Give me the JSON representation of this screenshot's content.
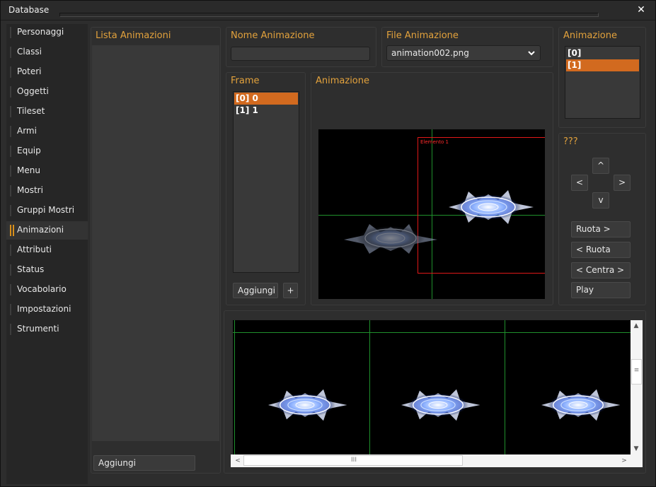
{
  "window": {
    "title": "Database",
    "close_symbol": "✕"
  },
  "sidebar": {
    "items": [
      {
        "label": "Personaggi",
        "active": false
      },
      {
        "label": "Classi",
        "active": false
      },
      {
        "label": "Poteri",
        "active": false
      },
      {
        "label": "Oggetti",
        "active": false
      },
      {
        "label": "Tileset",
        "active": false
      },
      {
        "label": "Armi",
        "active": false
      },
      {
        "label": "Equip",
        "active": false
      },
      {
        "label": "Menu",
        "active": false
      },
      {
        "label": "Mostri",
        "active": false
      },
      {
        "label": "Gruppi Mostri",
        "active": false
      },
      {
        "label": "Animazioni",
        "active": true
      },
      {
        "label": "Attributi",
        "active": false
      },
      {
        "label": "Status",
        "active": false
      },
      {
        "label": "Vocabolario",
        "active": false
      },
      {
        "label": "Impostazioni",
        "active": false
      },
      {
        "label": "Strumenti",
        "active": false
      }
    ]
  },
  "lista": {
    "title": "Lista Animazioni",
    "add_label": "Aggiungi"
  },
  "nome": {
    "title": "Nome Animazione",
    "value": ""
  },
  "file": {
    "title": "File Animazione",
    "selected": "animation002.png",
    "chevron_icon": "chevron-down-icon"
  },
  "animazione_list": {
    "title": "Animazione",
    "items": [
      {
        "text": "[0]",
        "selected": false
      },
      {
        "text": "[1]",
        "selected": true
      }
    ]
  },
  "frame": {
    "title": "Frame",
    "items": [
      {
        "text": "[0] 0",
        "selected": true
      },
      {
        "text": "[1] 1",
        "selected": false
      }
    ],
    "add_label": "Aggiungi",
    "plus_label": "+"
  },
  "preview": {
    "title": "Animazione",
    "element_label": "Elemento 1"
  },
  "controls": {
    "title": "???",
    "up": "^",
    "left": "<",
    "right": ">",
    "down": "v",
    "rotate_right": "Ruota >",
    "rotate_left": "< Ruota",
    "center": "< Centra >",
    "play": "Play"
  },
  "timeline": {
    "scroll_up": "▲",
    "scroll_down": "▼",
    "scroll_left": "<",
    "scroll_right": ">",
    "grip": "≡",
    "grip_h": "III"
  },
  "colors": {
    "accent_orange": "#d26a1f",
    "title_gold": "#e3a23c",
    "grid_green": "#1f8f2c",
    "box_red": "#e01818"
  }
}
